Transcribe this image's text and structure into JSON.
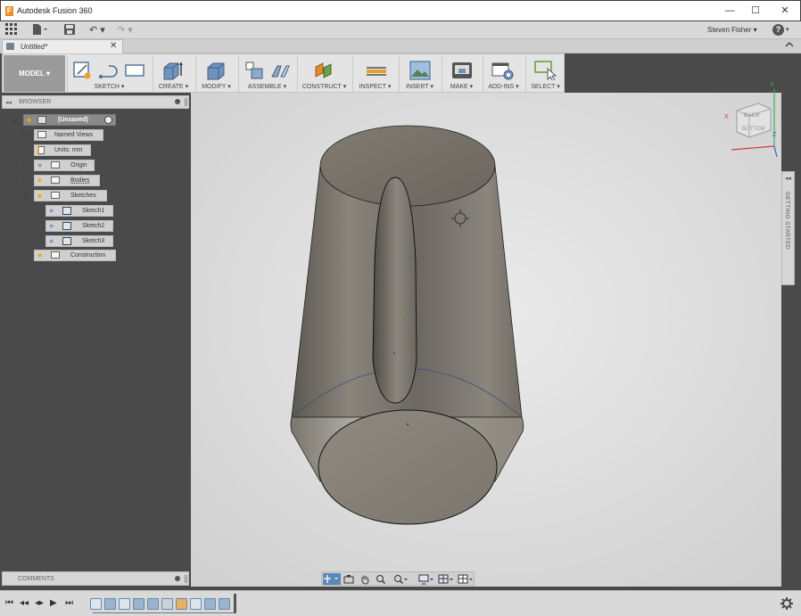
{
  "window": {
    "app_title": "Autodesk Fusion 360",
    "logo_letter": "F",
    "minimize": "—",
    "maximize": "☐",
    "close": "✕"
  },
  "appbar": {
    "user_name": "Steven Fisher ▾",
    "help_glyph": "?",
    "help_caret": "▾",
    "undo_glyph": "↶ ▾",
    "redo_glyph": "↷ ▾"
  },
  "tab": {
    "label": "Untitled*",
    "close": "✕"
  },
  "toolbar": {
    "mode_label": "MODEL ▾",
    "groups": [
      {
        "label": "SKETCH ▾"
      },
      {
        "label": "CREATE ▾"
      },
      {
        "label": "MODIFY ▾"
      },
      {
        "label": "ASSEMBLE ▾"
      },
      {
        "label": "CONSTRUCT ▾"
      },
      {
        "label": "INSPECT ▾"
      },
      {
        "label": "INSERT ▾"
      },
      {
        "label": "MAKE ▾"
      },
      {
        "label": "ADD-INS ▾"
      },
      {
        "label": "SELECT ▾"
      }
    ]
  },
  "browser": {
    "title": "BROWSER",
    "root": "(Unsaved)",
    "items": [
      {
        "label": "Named Views"
      },
      {
        "label": "Units: mm"
      },
      {
        "label": "Origin"
      },
      {
        "label": "Bodies"
      },
      {
        "label": "Sketches"
      },
      {
        "label": "Sketch1"
      },
      {
        "label": "Sketch2"
      },
      {
        "label": "Sketch3"
      },
      {
        "label": "Construction"
      }
    ]
  },
  "viewcube": {
    "face_back": "BACK",
    "face_bottom": "BOTTOM",
    "axis_x": "X",
    "axis_y": "Y",
    "axis_z": "Z"
  },
  "getting_started": "GETTING STARTED",
  "comments": {
    "title": "COMMENTS"
  },
  "colors": {
    "body_dark": "#5e5a54",
    "body_light": "#a8a39b",
    "accent_orange": "#f08a24",
    "selection_blue": "#4a7fb5"
  }
}
